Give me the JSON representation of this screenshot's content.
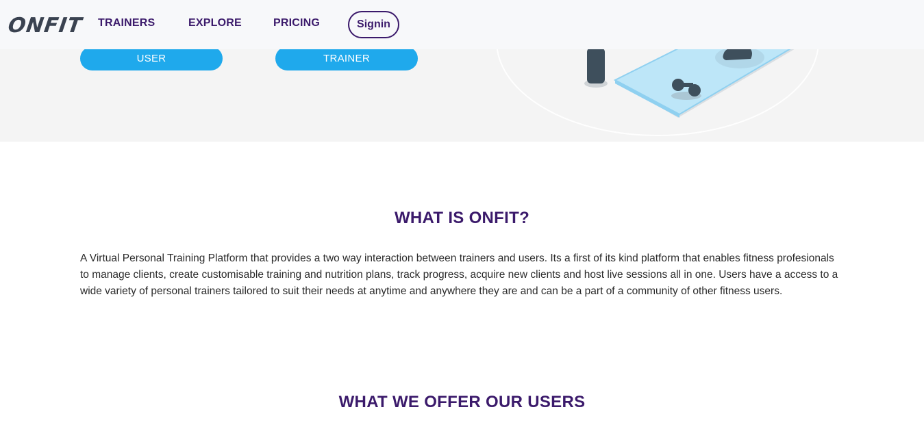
{
  "nav": {
    "logo": "ONFIT",
    "links": [
      {
        "label": "TRAINERS"
      },
      {
        "label": "EXPLORE"
      },
      {
        "label": "PRICING"
      }
    ],
    "signin_label": "Signin"
  },
  "hero": {
    "user_button": "USER",
    "trainer_button": "TRAINER"
  },
  "about": {
    "heading": "WHAT IS ONFIT?",
    "body": "A Virtual Personal Training Platform that provides a two way interaction between trainers and users. Its a first of its kind platform that enables fitness profesionals to manage clients, create customisable training and nutrition plans, track progress, acquire new clients and host live sessions all in one. Users have a access to a wide variety of personal trainers tailored to suit their needs at anytime and anywhere they are and can be a part of a community of other fitness users."
  },
  "offer": {
    "heading": "WHAT WE OFFER OUR USERS"
  },
  "colors": {
    "brand_purple": "#3b1a6b",
    "cta_blue": "#1fa9ec",
    "hero_bg": "#f4f4f4"
  }
}
